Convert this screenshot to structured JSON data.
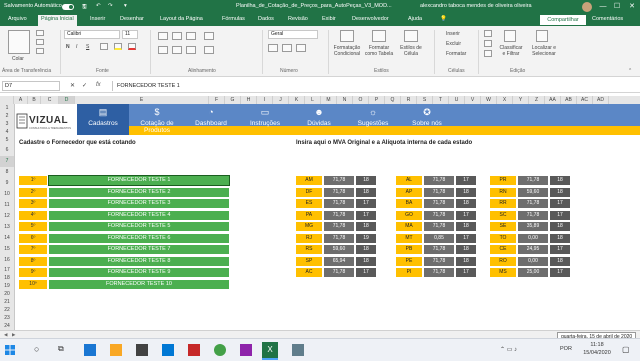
{
  "titlebar": {
    "autosave": "Salvamento Automático",
    "file_title": "Planilha_de_Cotação_de_Preços_para_AutoPeças_V3_MOD...",
    "user": "alexcandro taboca mendes de oliveira oliveira",
    "minimize": "—",
    "maximize": "☐",
    "close": "✕"
  },
  "ribbon_tabs": [
    "Arquivo",
    "Página Inicial",
    "Inserir",
    "Desenhar",
    "Layout da Página",
    "Fórmulas",
    "Dados",
    "Revisão",
    "Exibir",
    "Desenvolvedor",
    "Ajuda"
  ],
  "ribbon_search_icon": "lightbulb-icon",
  "share_label": "Compartilhar",
  "comments_label": "Comentários",
  "ribbon": {
    "paste": "Colar",
    "font_name": "Calibri",
    "font_size": "11",
    "bold": "N",
    "italic": "I",
    "underline": "S",
    "number_format": "Geral",
    "cond_format": "Formatação Condicional",
    "format_table": "Formatar como Tabela",
    "cell_styles": "Estilos de Célula",
    "insert": "Inserir",
    "delete": "Excluir",
    "format": "Formatar",
    "sort_filter": "Classificar e Filtrar",
    "find_select": "Localizar e Selecionar",
    "groups": {
      "clipboard": "Área de Transferência",
      "font": "Fonte",
      "alignment": "Alinhamento",
      "number": "Número",
      "styles": "Estilos",
      "cells": "Células",
      "editing": "Edição"
    }
  },
  "formula_bar": {
    "cell_ref": "D7",
    "fx": "fx",
    "formula": "FORNECEDOR TESTE 1"
  },
  "columns": [
    "A",
    "B",
    "C",
    "D",
    "E",
    "F",
    "G",
    "H",
    "I",
    "J",
    "K",
    "L",
    "M",
    "N",
    "O",
    "P",
    "Q",
    "R",
    "S",
    "T",
    "U",
    "V",
    "W",
    "X",
    "Y",
    "Z",
    "AA",
    "AB",
    "AC",
    "AD"
  ],
  "selected_column": "D",
  "rows": [
    "1",
    "2",
    "3",
    "4",
    "5",
    "6",
    "7",
    "8",
    "9",
    "10",
    "11",
    "12",
    "13",
    "14",
    "15",
    "16",
    "17",
    "18",
    "19",
    "20",
    "21",
    "22",
    "23",
    "24",
    "25",
    "26",
    "27",
    "28",
    "29",
    "30",
    "31"
  ],
  "selected_row": "7",
  "logo": {
    "text": "VIZUAL",
    "subtitle": "CONSULTORIA & TREINAMENTOS"
  },
  "menu": [
    {
      "label": "Cadastros",
      "icon": "file-icon"
    },
    {
      "label": "Cotação de Produtos",
      "icon": "dollar-icon"
    },
    {
      "label": "Dashboard",
      "icon": "pie-chart-icon"
    },
    {
      "label": "Instruções",
      "icon": "laptop-icon"
    },
    {
      "label": "Dúvidas",
      "icon": "people-icon"
    },
    {
      "label": "Sugestões",
      "icon": "lightbulb-icon"
    },
    {
      "label": "Sobre nós",
      "icon": "badge-icon"
    }
  ],
  "active_menu": "Cadastros",
  "suppliers_section": {
    "title": "Cadastre o Fornecedor que está cotando",
    "rows": [
      {
        "num": "1º",
        "name": "FORNECEDOR TESTE 1"
      },
      {
        "num": "2º",
        "name": "FORNECEDOR TESTE 2"
      },
      {
        "num": "3º",
        "name": "FORNECEDOR TESTE 3"
      },
      {
        "num": "4º",
        "name": "FORNECEDOR TESTE 4"
      },
      {
        "num": "5º",
        "name": "FORNECEDOR TESTE 5"
      },
      {
        "num": "6º",
        "name": "FORNECEDOR TESTE 6"
      },
      {
        "num": "7º",
        "name": "FORNECEDOR TESTE 7"
      },
      {
        "num": "8º",
        "name": "FORNECEDOR TESTE 8"
      },
      {
        "num": "9º",
        "name": "FORNECEDOR TESTE 9"
      },
      {
        "num": "10º",
        "name": "FORNECEDOR TESTE 10"
      }
    ]
  },
  "states_section": {
    "title": "Insira aqui o MVA Original e a Alíquota interna de cada estado",
    "col1": [
      {
        "uf": "AM",
        "mva": "71,78",
        "aliq": "18"
      },
      {
        "uf": "DF",
        "mva": "71,78",
        "aliq": "18"
      },
      {
        "uf": "ES",
        "mva": "71,78",
        "aliq": "17"
      },
      {
        "uf": "PA",
        "mva": "71,78",
        "aliq": "17"
      },
      {
        "uf": "MG",
        "mva": "71,78",
        "aliq": "18"
      },
      {
        "uf": "RJ",
        "mva": "71,78",
        "aliq": "19"
      },
      {
        "uf": "RS",
        "mva": "59,60",
        "aliq": "18"
      },
      {
        "uf": "SP",
        "mva": "65,94",
        "aliq": "18"
      },
      {
        "uf": "AC",
        "mva": "71,78",
        "aliq": "17"
      }
    ],
    "col2": [
      {
        "uf": "AL",
        "mva": "71,78",
        "aliq": "17"
      },
      {
        "uf": "AP",
        "mva": "71,78",
        "aliq": "18"
      },
      {
        "uf": "BA",
        "mva": "71,78",
        "aliq": "18"
      },
      {
        "uf": "GO",
        "mva": "71,78",
        "aliq": "17"
      },
      {
        "uf": "MA",
        "mva": "71,78",
        "aliq": "18"
      },
      {
        "uf": "MT",
        "mva": "0,85",
        "aliq": "17"
      },
      {
        "uf": "PB",
        "mva": "71,78",
        "aliq": "18"
      },
      {
        "uf": "PE",
        "mva": "71,78",
        "aliq": "18"
      },
      {
        "uf": "PI",
        "mva": "71,78",
        "aliq": "17"
      }
    ],
    "col3": [
      {
        "uf": "PR",
        "mva": "71,78",
        "aliq": "18"
      },
      {
        "uf": "RN",
        "mva": "59,60",
        "aliq": "18"
      },
      {
        "uf": "RR",
        "mva": "71,78",
        "aliq": "17"
      },
      {
        "uf": "SC",
        "mva": "71,78",
        "aliq": "17"
      },
      {
        "uf": "SE",
        "mva": "35,89",
        "aliq": "18"
      },
      {
        "uf": "TO",
        "mva": "0,00",
        "aliq": "18"
      },
      {
        "uf": "CE",
        "mva": "24,95",
        "aliq": "17"
      },
      {
        "uf": "RO",
        "mva": "0,00",
        "aliq": "18"
      },
      {
        "uf": "MS",
        "mva": "25,00",
        "aliq": "17"
      }
    ]
  },
  "tooltip": "quarta-feira, 15 de abril de 2020",
  "clock": {
    "time": "11:18",
    "date": "15/04/2020"
  },
  "taskbar_lang": "POR"
}
